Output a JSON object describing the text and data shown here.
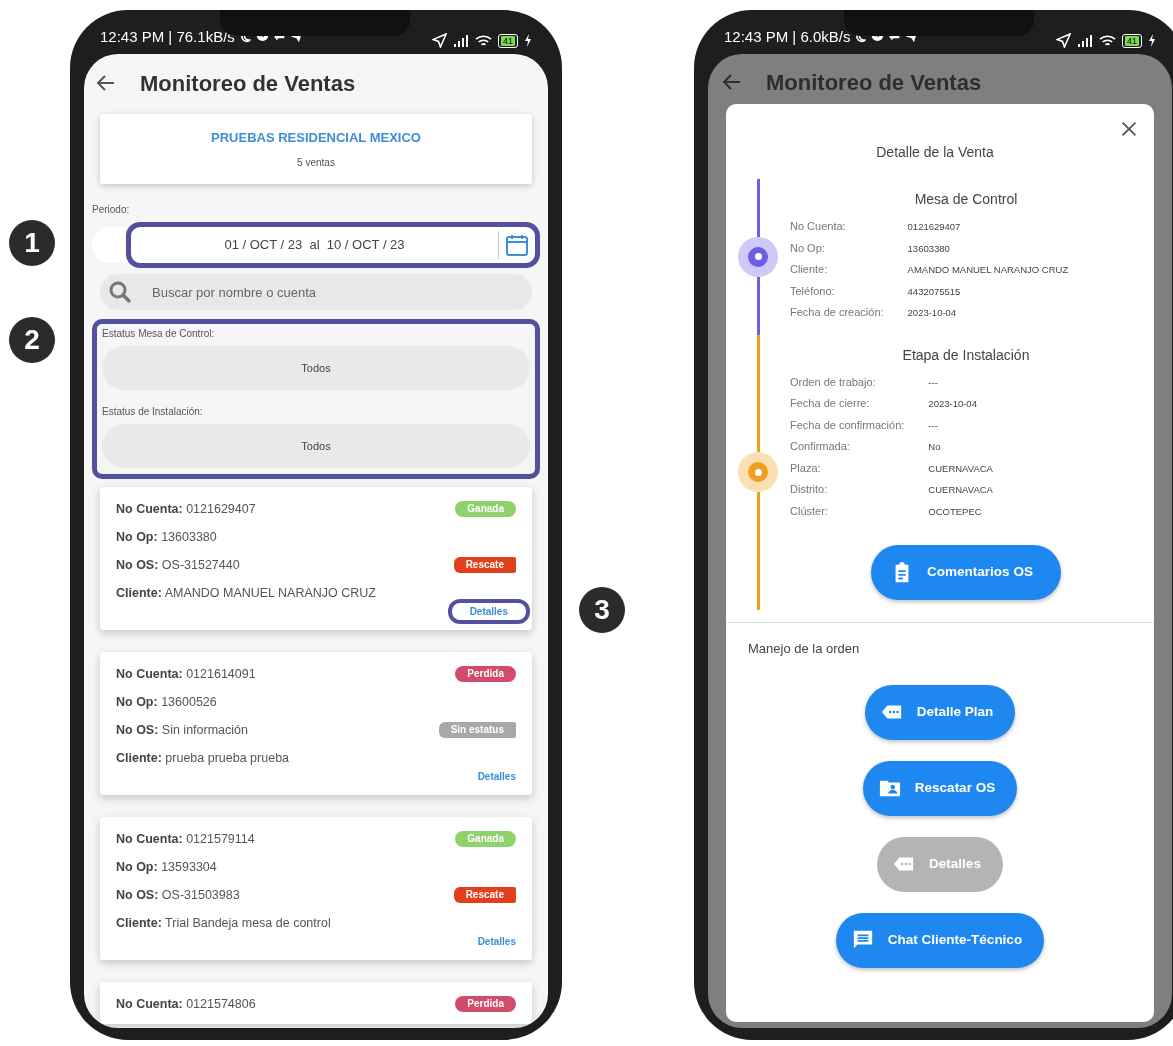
{
  "callouts": [
    {
      "number": "1"
    },
    {
      "number": "2"
    },
    {
      "number": "3"
    }
  ],
  "list_screen": {
    "status_bar": {
      "text": "12:43 PM | 76.1kB/s",
      "battery": "41"
    },
    "title": "Monitoreo de Ventas",
    "account_card": {
      "name": "PRUEBAS RESIDENCIAL MEXICO",
      "count": "5 ventas"
    },
    "period": {
      "label": "Periodo:",
      "value": "01 / OCT / 23  al  10 / OCT / 23",
      "highlighted": true
    },
    "search": {
      "placeholder": "Buscar por nombre o cuenta"
    },
    "filters": {
      "highlighted": true,
      "items": [
        {
          "label": "Estatus Mesa de Control:",
          "value": "Todos"
        },
        {
          "label": "Estatus de Instalación:",
          "value": "Todos"
        }
      ]
    },
    "sales": [
      {
        "fields": [
          {
            "label": "No Cuenta:",
            "value": "0121629407",
            "badge": {
              "text": "Ganada",
              "kind": "won"
            }
          },
          {
            "label": "No Op:",
            "value": "13603380"
          },
          {
            "label": "No OS:",
            "value": "OS-31527440",
            "badge": {
              "text": "Rescate",
              "kind": "rescue"
            }
          },
          {
            "label": "Cliente:",
            "value": "AMANDO MANUEL NARANJO CRUZ"
          }
        ],
        "link": {
          "text": "Detalles",
          "highlighted": true
        }
      },
      {
        "fields": [
          {
            "label": "No Cuenta:",
            "value": "0121614091",
            "badge": {
              "text": "Perdida",
              "kind": "lost"
            }
          },
          {
            "label": "No Op:",
            "value": "13600526"
          },
          {
            "label": "No OS:",
            "value": "Sin información",
            "badge": {
              "text": "Sin estatus",
              "kind": "none"
            }
          },
          {
            "label": "Cliente:",
            "value": "prueba prueba prueba"
          }
        ],
        "link": {
          "text": "Detalles",
          "highlighted": false
        }
      },
      {
        "fields": [
          {
            "label": "No Cuenta:",
            "value": "0121579114",
            "badge": {
              "text": "Ganada",
              "kind": "won"
            }
          },
          {
            "label": "No Op:",
            "value": "13593304"
          },
          {
            "label": "No OS:",
            "value": "OS-31503983",
            "badge": {
              "text": "Rescate",
              "kind": "rescue"
            }
          },
          {
            "label": "Cliente:",
            "value": "Trial Bandeja mesa de control"
          }
        ],
        "link": {
          "text": "Detalles",
          "highlighted": false
        }
      },
      {
        "fields": [
          {
            "label": "No Cuenta:",
            "value": "0121574806",
            "badge": {
              "text": "Perdida",
              "kind": "lost"
            }
          }
        ]
      }
    ]
  },
  "detail_screen": {
    "status_bar": {
      "text": "12:43 PM | 6.0kB/s",
      "battery": "41"
    },
    "title": "Monitoreo de Ventas",
    "modal": {
      "title": "Detalle de la Venta",
      "sections": [
        {
          "heading": "Mesa de Control",
          "color": "#6f5de6",
          "rows": [
            {
              "label": "No Cuenta:",
              "value": "0121629407"
            },
            {
              "label": "No Op:",
              "value": "13603380"
            },
            {
              "label": "Cliente:",
              "value": "AMANDO MANUEL NARANJO CRUZ"
            },
            {
              "label": "Teléfono:",
              "value": "4432075515"
            },
            {
              "label": "Fecha de creación:",
              "value": "2023-10-04"
            }
          ]
        },
        {
          "heading": "Etapa de Instalación",
          "color": "#f0a020",
          "rows": [
            {
              "label": "Orden de trabajo:",
              "value": "---"
            },
            {
              "label": "Fecha de cierre:",
              "value": "2023-10-04"
            },
            {
              "label": "Fecha de confirmación:",
              "value": "---"
            },
            {
              "label": "Confirmada:",
              "value": "No"
            },
            {
              "label": "Plaza:",
              "value": "CUERNAVACA"
            },
            {
              "label": "Distrito:",
              "value": "CUERNAVACA"
            },
            {
              "label": "Clúster:",
              "value": "OCOTEPEC"
            }
          ],
          "button": {
            "label": "Comentarios OS",
            "kind": "clipboard"
          }
        }
      ],
      "manage_heading": "Manejo de la orden",
      "actions": [
        {
          "label": "Detalle Plan",
          "kind": "tag",
          "disabled": false
        },
        {
          "label": "Rescatar OS",
          "kind": "folder",
          "disabled": false
        },
        {
          "label": "Detalles",
          "kind": "tag",
          "disabled": true
        },
        {
          "label": "Chat Cliente-Técnico",
          "kind": "chat",
          "disabled": false
        }
      ]
    }
  }
}
